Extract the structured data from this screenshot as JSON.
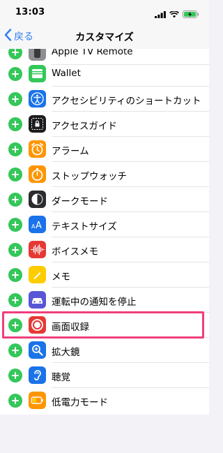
{
  "status": {
    "time": "13:03"
  },
  "nav": {
    "back_label": "戻る",
    "title": "カスタマイズ"
  },
  "items": [
    {
      "label": "Apple TV Remote",
      "icon": "apple-tv-remote-icon"
    },
    {
      "label": "Wallet",
      "icon": "wallet-icon"
    },
    {
      "label": "アクセシビリティのショートカット",
      "icon": "accessibility-icon"
    },
    {
      "label": "アクセスガイド",
      "icon": "guided-access-icon"
    },
    {
      "label": "アラーム",
      "icon": "alarm-icon"
    },
    {
      "label": "ストップウォッチ",
      "icon": "stopwatch-icon"
    },
    {
      "label": "ダークモード",
      "icon": "dark-mode-icon"
    },
    {
      "label": "テキストサイズ",
      "icon": "text-size-icon"
    },
    {
      "label": "ボイスメモ",
      "icon": "voice-memos-icon"
    },
    {
      "label": "メモ",
      "icon": "notes-icon"
    },
    {
      "label": "運転中の通知を停止",
      "icon": "do-not-disturb-driving-icon"
    },
    {
      "label": "画面収録",
      "icon": "screen-recording-icon"
    },
    {
      "label": "拡大鏡",
      "icon": "magnifier-icon"
    },
    {
      "label": "聴覚",
      "icon": "hearing-icon"
    },
    {
      "label": "低電力モード",
      "icon": "low-power-mode-icon"
    }
  ],
  "colors": {
    "accent": "#2f7df6",
    "add": "#34c759",
    "highlight": "#ef3e7b"
  }
}
